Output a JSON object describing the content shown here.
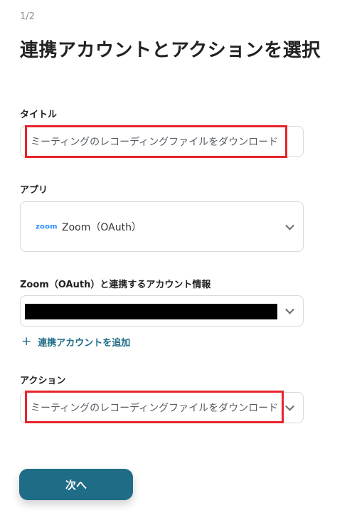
{
  "header": {
    "step": "1/2",
    "title": "連携アカウントとアクションを選択"
  },
  "title_field": {
    "label": "タイトル",
    "value": "ミーティングのレコーディングファイルをダウンロード"
  },
  "app_field": {
    "label": "アプリ",
    "logo_text": "zoom",
    "value": "Zoom（OAuth）"
  },
  "account_field": {
    "label": "Zoom（OAuth）と連携するアカウント情報",
    "value_redacted": true,
    "add_link_label": "連携アカウントを追加"
  },
  "action_field": {
    "label": "アクション",
    "value": "ミーティングのレコーディングファイルをダウンロード"
  },
  "footer": {
    "next_label": "次へ"
  },
  "colors": {
    "accent": "#1f6c87",
    "highlight": "#e8232b",
    "zoom_brand": "#2d8cff"
  }
}
